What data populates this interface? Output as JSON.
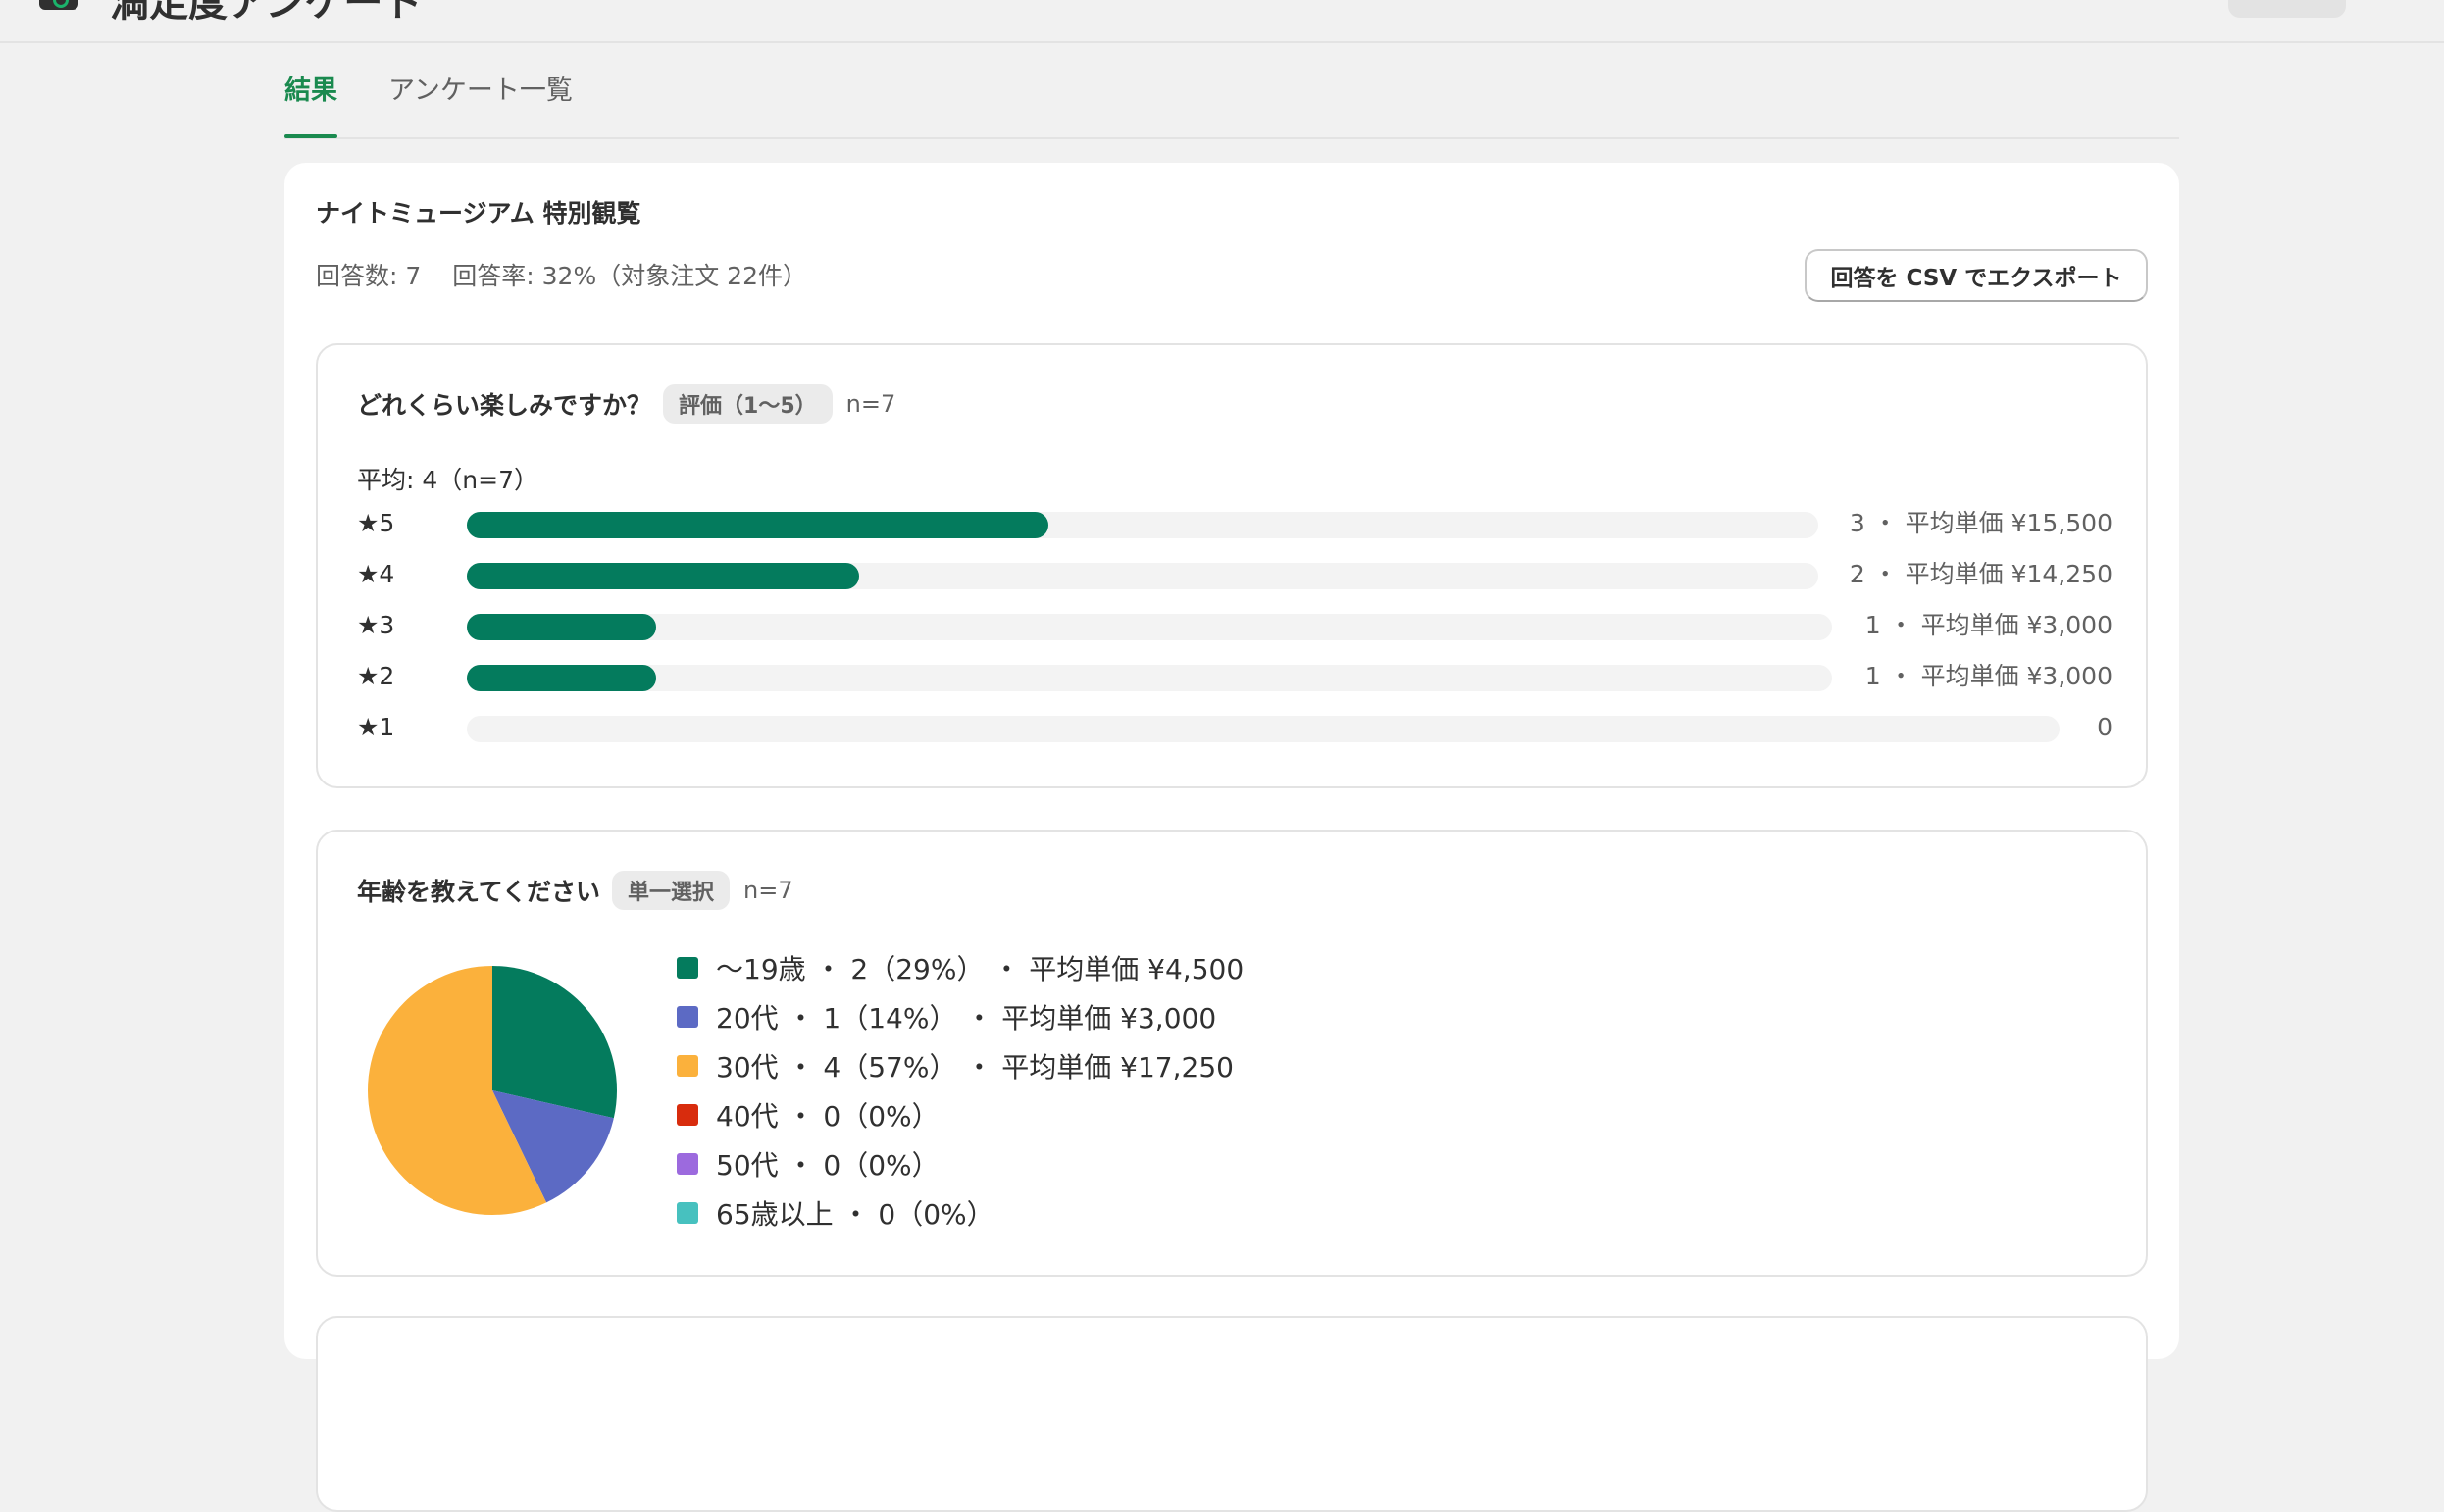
{
  "header": {
    "title": "満足度アンケート"
  },
  "tabs": [
    {
      "label": "結果",
      "active": true
    },
    {
      "label": "アンケート一覧",
      "active": false
    }
  ],
  "survey": {
    "title": "ナイトミュージアム 特別観覧",
    "responses": "回答数: 7",
    "rate": "回答率: 32%（対象注文 22件）",
    "export_label": "回答を CSV でエクスポート"
  },
  "q1": {
    "title": "どれくらい楽しみですか？",
    "badge": "評価（1〜5）",
    "n": "n=7",
    "average": "平均: 4（n=7）",
    "rows": [
      {
        "label": "★5",
        "count": 3,
        "meta": "3 ・ 平均単価 ¥15,500",
        "fraction": 0.43
      },
      {
        "label": "★4",
        "count": 2,
        "meta": "2 ・ 平均単価 ¥14,250",
        "fraction": 0.29
      },
      {
        "label": "★3",
        "count": 1,
        "meta": "1 ・ 平均単価 ¥3,000",
        "fraction": 0.14
      },
      {
        "label": "★2",
        "count": 1,
        "meta": "1 ・ 平均単価 ¥3,000",
        "fraction": 0.14
      },
      {
        "label": "★1",
        "count": 0,
        "meta": "0",
        "fraction": 0
      }
    ],
    "bar_color": "#047b5d"
  },
  "q2": {
    "title": "年齢を教えてください",
    "badge": "単一選択",
    "n": "n=7",
    "legend": [
      {
        "text": "〜19歳 ・ 2（29%） ・ 平均単価 ¥4,500",
        "color": "#047b5d"
      },
      {
        "text": "20代 ・ 1（14%） ・ 平均単価 ¥3,000",
        "color": "#5c6ac4"
      },
      {
        "text": "30代 ・ 4（57%） ・ 平均単価 ¥17,250",
        "color": "#fbb13c"
      },
      {
        "text": "40代 ・ 0（0%）",
        "color": "#d82c0d"
      },
      {
        "text": "50代 ・ 0（0%）",
        "color": "#9c6ade"
      },
      {
        "text": "65歳以上 ・ 0（0%）",
        "color": "#47c1bf"
      }
    ]
  },
  "chart_data": {
    "type": "pie",
    "categories": [
      "〜19歳",
      "20代",
      "30代",
      "40代",
      "50代",
      "65歳以上"
    ],
    "values": [
      2,
      1,
      4,
      0,
      0,
      0
    ],
    "colors": [
      "#047b5d",
      "#5c6ac4",
      "#fbb13c",
      "#d82c0d",
      "#9c6ade",
      "#47c1bf"
    ],
    "legend": "right"
  }
}
